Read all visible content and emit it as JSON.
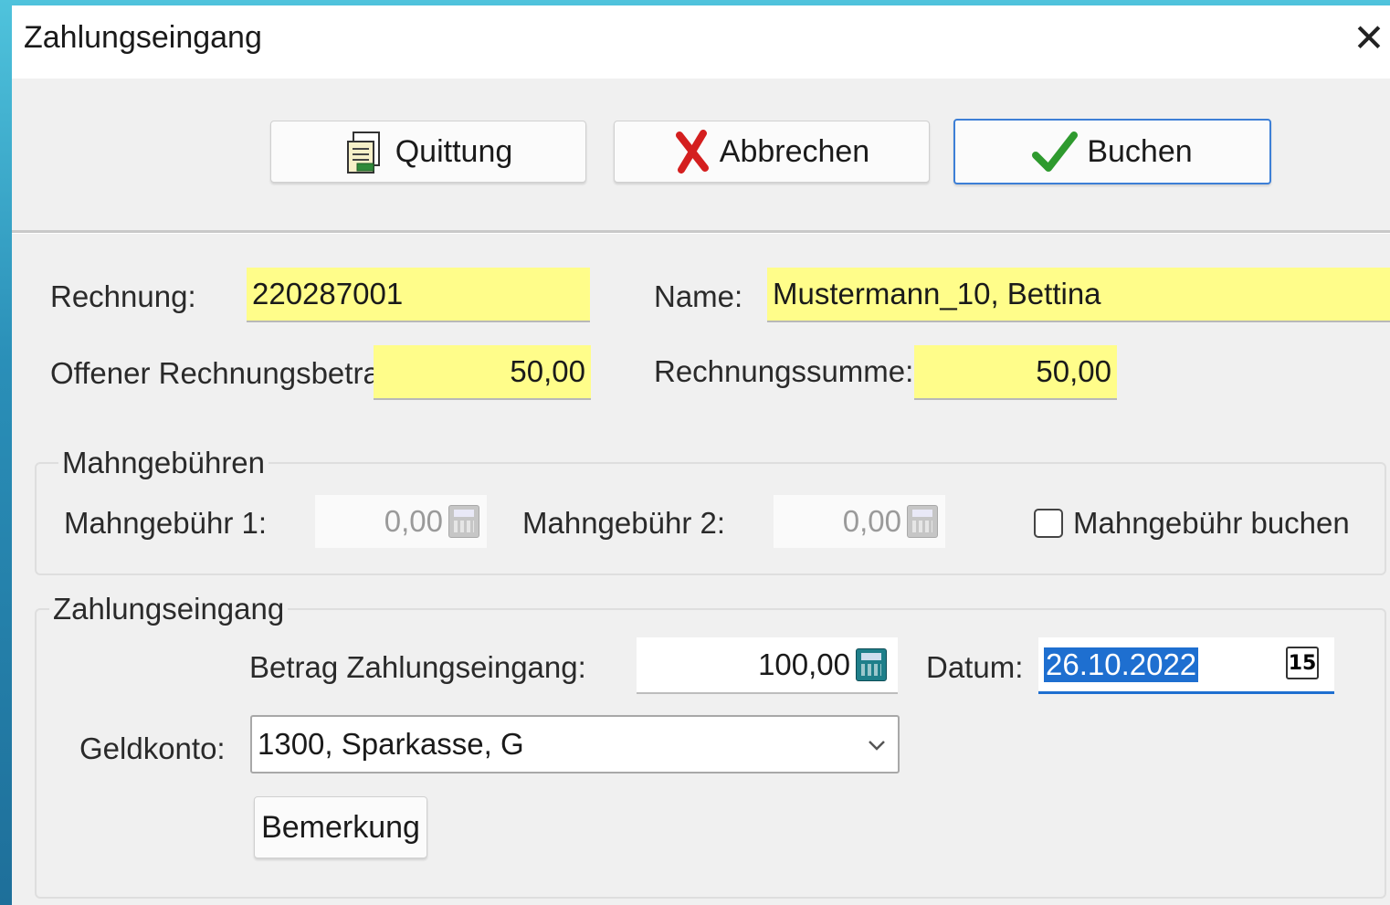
{
  "window": {
    "title": "Zahlungseingang",
    "close_glyph": "✕"
  },
  "toolbar": {
    "receipt_label": "Quittung",
    "cancel_label": "Abbrechen",
    "book_label": "Buchen"
  },
  "invoice": {
    "number_label": "Rechnung:",
    "number_value": "220287001",
    "name_label": "Name:",
    "name_value": "Mustermann_10,  Bettina",
    "open_amount_label": "Offener Rechnungsbetrag:",
    "open_amount_value": "50,00",
    "total_label": "Rechnungssumme:",
    "total_value": "50,00"
  },
  "fees": {
    "group_title": "Mahngebühren",
    "fee1_label": "Mahngebühr 1:",
    "fee1_value": "0,00",
    "fee2_label": "Mahngebühr 2:",
    "fee2_value": "0,00",
    "book_fee_label": "Mahngebühr buchen",
    "book_fee_checked": false
  },
  "payment": {
    "group_title": "Zahlungseingang",
    "amount_label": "Betrag Zahlungseingang:",
    "amount_value": "100,00",
    "date_label": "Datum:",
    "date_value": "26.10.2022",
    "calendar_day": "15",
    "account_label": "Geldkonto:",
    "account_value": "1300, Sparkasse, G",
    "remark_label": "Bemerkung"
  },
  "colors": {
    "highlight_field": "#fffd8a",
    "default_button_border": "#3d7fd6",
    "selection": "#1e6fd0",
    "cancel_icon": "#d41f1f",
    "check_icon": "#2e9a2e"
  }
}
